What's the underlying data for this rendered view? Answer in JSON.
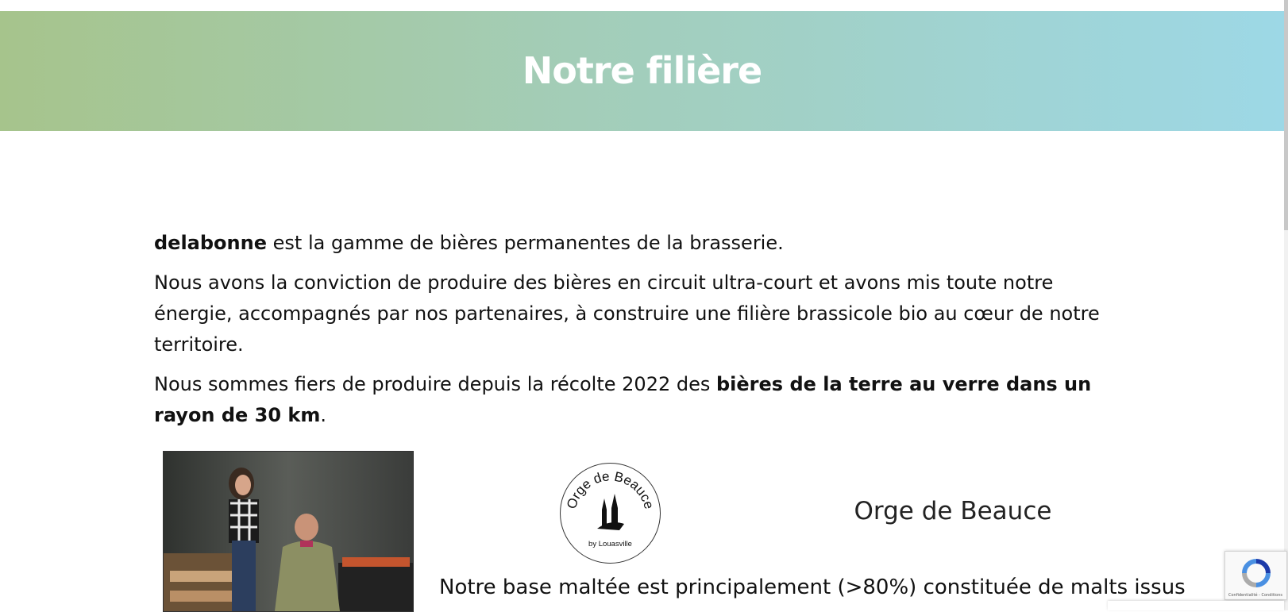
{
  "hero": {
    "title": "Notre filière"
  },
  "intro": {
    "p1_bold": "delabonne",
    "p1_rest": " est la gamme de bières permanentes de la brasserie.",
    "p2": "Nous avons la conviction de produire des bières en circuit ultra-court et avons mis toute notre énergie, accompagnés par nos partenaires, à construire une filière brassicole bio au cœur de notre territoire.",
    "p3_start": "Nous sommes fiers de produire depuis la récolte 2022 des ",
    "p3_bold": "bières de la terre au verre dans un rayon de 30 km",
    "p3_end": "."
  },
  "orge": {
    "logo_top": "Orge de Beauce",
    "logo_bottom": "by Louasville",
    "title": "Orge de Beauce",
    "description": "Notre base maltée est principalement (>80%) constituée de malts issus"
  },
  "recaptcha": {
    "legal": "Confidentialité - Conditions"
  },
  "colors": {
    "gradient_start": "#a6c48c",
    "gradient_end": "#9dd8e6"
  }
}
